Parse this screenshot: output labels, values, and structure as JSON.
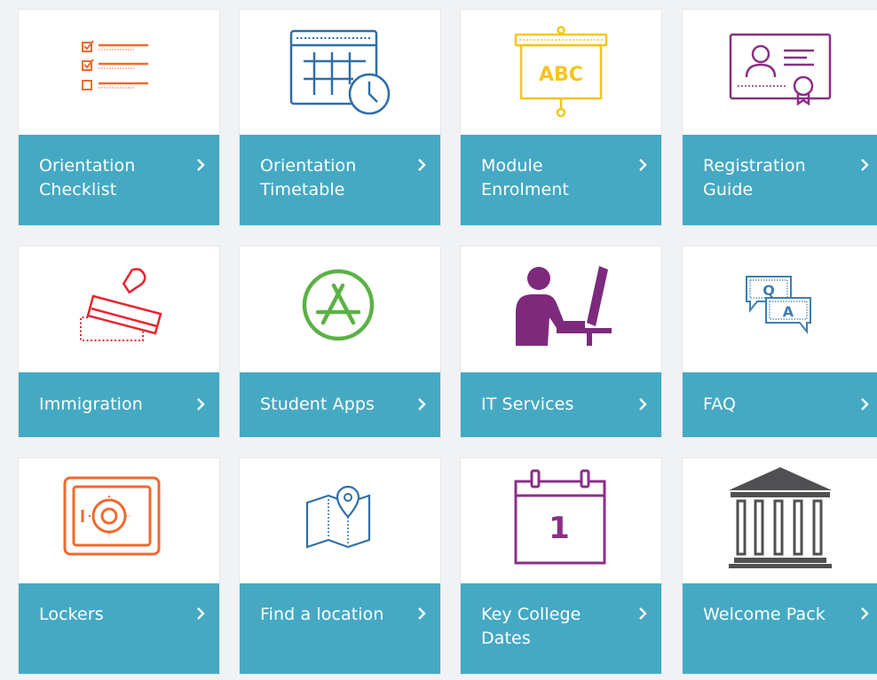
{
  "colors": {
    "tile_bar": "#45a9c4",
    "page_bg": "#f1f2f4",
    "orange": "#ef6a2f",
    "blue": "#2f6ea8",
    "yellow": "#f5c51d",
    "purple": "#8a2f86",
    "red": "#e8242f",
    "green": "#5cb146",
    "dark_purple": "#7d2a7d",
    "teal_blue": "#3d7fb2",
    "gray": "#505052"
  },
  "tiles": [
    {
      "line1": "Orientation",
      "line2": "Checklist",
      "icon": "checklist-icon"
    },
    {
      "line1": "Orientation",
      "line2": "Timetable",
      "icon": "timetable-icon"
    },
    {
      "line1": "Module",
      "line2": "Enrolment",
      "icon": "presentation-board-icon"
    },
    {
      "line1": "Registration",
      "line2": "Guide",
      "icon": "id-card-icon"
    },
    {
      "line1": "Immigration",
      "line2": "",
      "icon": "stamp-icon"
    },
    {
      "line1": "Student Apps",
      "line2": "",
      "icon": "app-store-icon"
    },
    {
      "line1": "IT Services",
      "line2": "",
      "icon": "computer-user-icon"
    },
    {
      "line1": "FAQ",
      "line2": "",
      "icon": "qa-speech-bubbles-icon"
    },
    {
      "line1": "Lockers",
      "line2": "",
      "icon": "safe-icon"
    },
    {
      "line1": "Find a location",
      "line2": "",
      "icon": "map-pin-icon"
    },
    {
      "line1": "Key College",
      "line2": "Dates",
      "icon": "calendar-icon"
    },
    {
      "line1": "Welcome Pack",
      "line2": "",
      "icon": "building-icon"
    }
  ],
  "calendar_day": "1",
  "abc_text": "ABC",
  "faq_q": "Q",
  "faq_a": "A"
}
